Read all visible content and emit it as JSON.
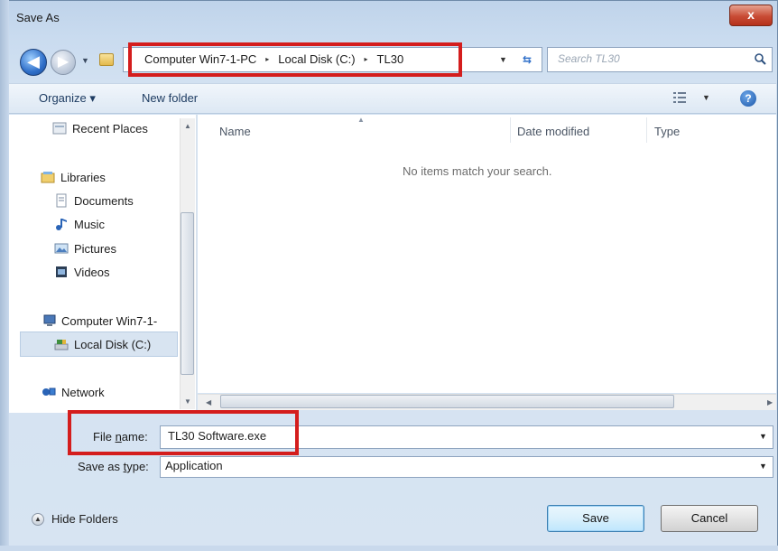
{
  "window": {
    "title": "Save As",
    "close_label": "x"
  },
  "nav_buttons": {
    "back": "◀",
    "forward": "▶"
  },
  "address": {
    "crumbs": [
      "Computer Win7-1-PC",
      "Local Disk (C:)",
      "TL30"
    ],
    "separator": "▸"
  },
  "search": {
    "placeholder": "Search TL30"
  },
  "toolbar": {
    "organize_label": "Organize ▾",
    "new_folder_label": "New folder"
  },
  "nav_pane": {
    "items": [
      {
        "label": "Recent Places",
        "icon": "recent-places-icon"
      },
      {
        "label": "Libraries",
        "icon": "libraries-icon"
      },
      {
        "label": "Documents",
        "icon": "documents-icon"
      },
      {
        "label": "Music",
        "icon": "music-icon"
      },
      {
        "label": "Pictures",
        "icon": "pictures-icon"
      },
      {
        "label": "Videos",
        "icon": "videos-icon"
      },
      {
        "label": "Computer Win7-1-",
        "icon": "computer-icon"
      },
      {
        "label": "Local Disk (C:)",
        "icon": "local-disk-icon",
        "selected": true
      },
      {
        "label": "Network",
        "icon": "network-icon"
      }
    ]
  },
  "file_list": {
    "columns": [
      "Name",
      "Date modified",
      "Type"
    ],
    "empty_message": "No items match your search."
  },
  "form": {
    "file_name_label_pre": "File ",
    "file_name_label_key": "n",
    "file_name_label_post": "ame:",
    "file_name_value": "TL30 Software.exe",
    "save_type_label_pre": "Save as ",
    "save_type_label_key": "t",
    "save_type_label_post": "ype:",
    "save_type_value": "Application"
  },
  "footer": {
    "hide_folders_label": "Hide Folders",
    "save_label": "Save",
    "cancel_label": "Cancel"
  },
  "colors": {
    "highlight_outline": "#d41d1d",
    "accent": "#2f6fc9"
  }
}
